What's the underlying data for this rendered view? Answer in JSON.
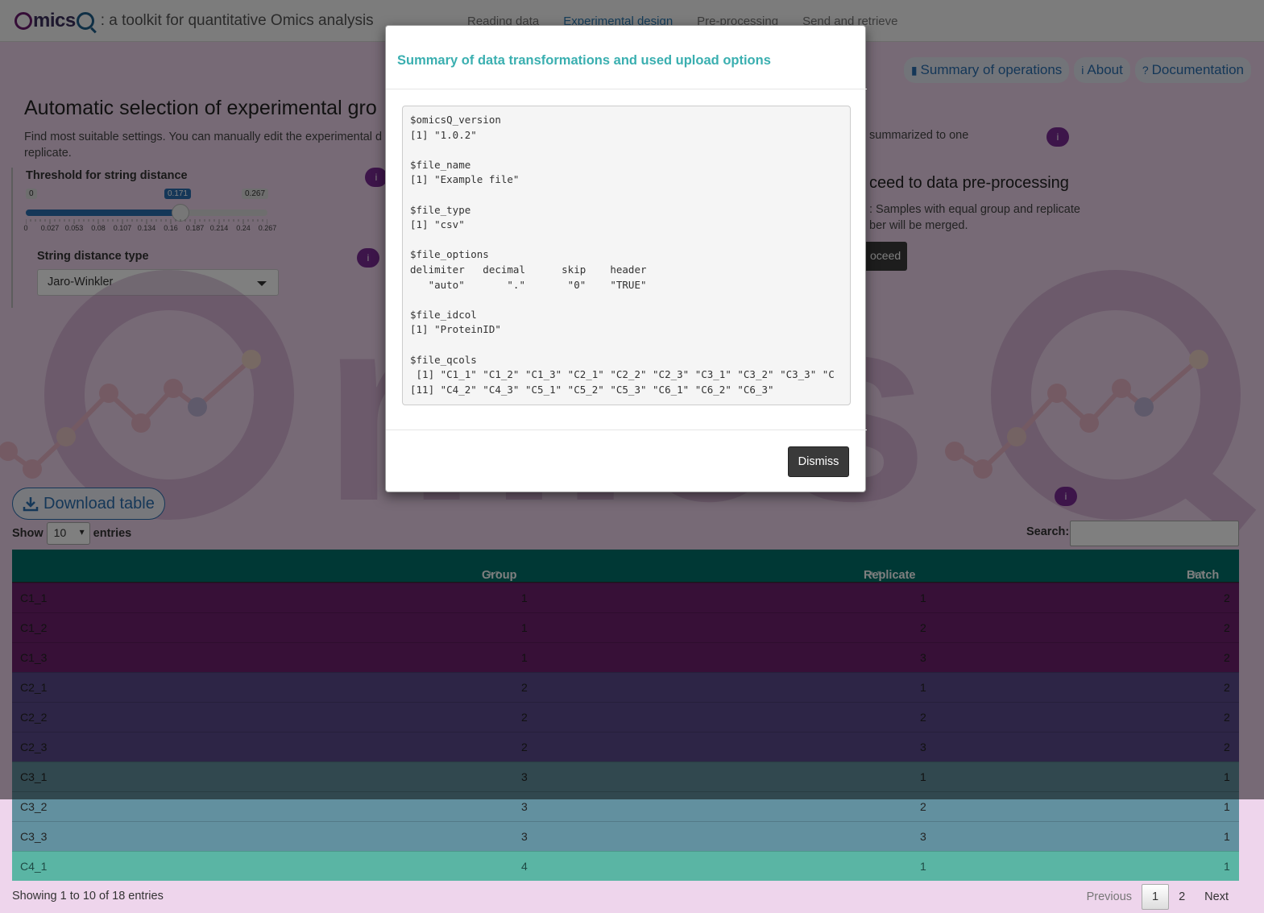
{
  "header": {
    "logo_text": "OmicsQ",
    "tagline": ": a toolkit for quantitative Omics analysis",
    "tabs": [
      {
        "label": "Reading data"
      },
      {
        "label": "Experimental design"
      },
      {
        "label": "Pre-processing"
      },
      {
        "label": "Send and retrieve"
      }
    ],
    "active_tab": "Experimental design"
  },
  "top_buttons": {
    "summary": "Summary of operations",
    "about": "About",
    "documentation": "Documentation"
  },
  "page": {
    "title": "Automatic selection of experimental gro",
    "description": "Find most suitable settings. You can manually edit the experimental d",
    "description_line2": "replicate.",
    "description_right": "summarized to one"
  },
  "slider": {
    "label": "Threshold for string distance",
    "min": "0",
    "max": "0.267",
    "value": "0.171",
    "value_fraction": 0.64,
    "ticks": [
      "0",
      "0.027",
      "0.053",
      "0.08",
      "0.107",
      "0.134",
      "0.16",
      "0.187",
      "0.214",
      "0.24",
      "0.267"
    ]
  },
  "string_distance": {
    "label": "String distance type",
    "selected": "Jaro-Winkler"
  },
  "proceed": {
    "heading": "ceed to data pre-processing",
    "note_line1": ": Samples with equal group and replicate",
    "note_line2": "ber will be merged.",
    "button": "oceed"
  },
  "download": {
    "label": "Download table"
  },
  "table_controls": {
    "show_label": "Show",
    "entries_value": "10",
    "entries_label": "entries",
    "search_label": "Search:",
    "info": "Showing 1 to 10 of 18 entries",
    "previous": "Previous",
    "pages": [
      "1",
      "2"
    ],
    "next": "Next"
  },
  "table": {
    "columns": [
      "Group",
      "Replicate",
      "Batch"
    ],
    "rows": [
      {
        "name": "C1_1",
        "group": "1",
        "replicate": "1",
        "batch": "2",
        "color": "#6e206e"
      },
      {
        "name": "C1_2",
        "group": "1",
        "replicate": "2",
        "batch": "2",
        "color": "#6e206e"
      },
      {
        "name": "C1_3",
        "group": "1",
        "replicate": "3",
        "batch": "2",
        "color": "#6e206e"
      },
      {
        "name": "C2_1",
        "group": "2",
        "replicate": "1",
        "batch": "2",
        "color": "#5a4a8c"
      },
      {
        "name": "C2_2",
        "group": "2",
        "replicate": "2",
        "batch": "2",
        "color": "#5a4a8c"
      },
      {
        "name": "C2_3",
        "group": "2",
        "replicate": "3",
        "batch": "2",
        "color": "#5a4a8c"
      },
      {
        "name": "C3_1",
        "group": "3",
        "replicate": "1",
        "batch": "1",
        "color": "#62909f"
      },
      {
        "name": "C3_2",
        "group": "3",
        "replicate": "2",
        "batch": "1",
        "color": "#62909f"
      },
      {
        "name": "C3_3",
        "group": "3",
        "replicate": "3",
        "batch": "1",
        "color": "#62909f"
      },
      {
        "name": "C4_1",
        "group": "4",
        "replicate": "1",
        "batch": "1",
        "color": "#5ab5a4"
      }
    ]
  },
  "modal": {
    "title": "Summary of data transformations and used upload options",
    "lines": [
      "$omicsQ_version",
      "[1] \"1.0.2\"",
      "",
      "$file_name",
      "[1] \"Example file\"",
      "",
      "$file_type",
      "[1] \"csv\"",
      "",
      "$file_options",
      "delimiter   decimal      skip    header",
      "   \"auto\"       \".\"       \"0\"    \"TRUE\"",
      "",
      "$file_idcol",
      "[1] \"ProteinID\"",
      "",
      "$file_qcols",
      " [1] \"C1_1\" \"C1_2\" \"C1_3\" \"C2_1\" \"C2_2\" \"C2_3\" \"C3_1\" \"C3_2\" \"C3_3\" \"C",
      "[11] \"C4_2\" \"C4_3\" \"C5_1\" \"C5_2\" \"C5_3\" \"C6_1\" \"C6_2\" \"C6_3\""
    ],
    "dismiss": "Dismiss"
  },
  "colors": {
    "accent": "#2a6eb0",
    "header_teal": "#00706b",
    "info_purple": "#7a2a94",
    "modal_title": "#3aafb0"
  }
}
